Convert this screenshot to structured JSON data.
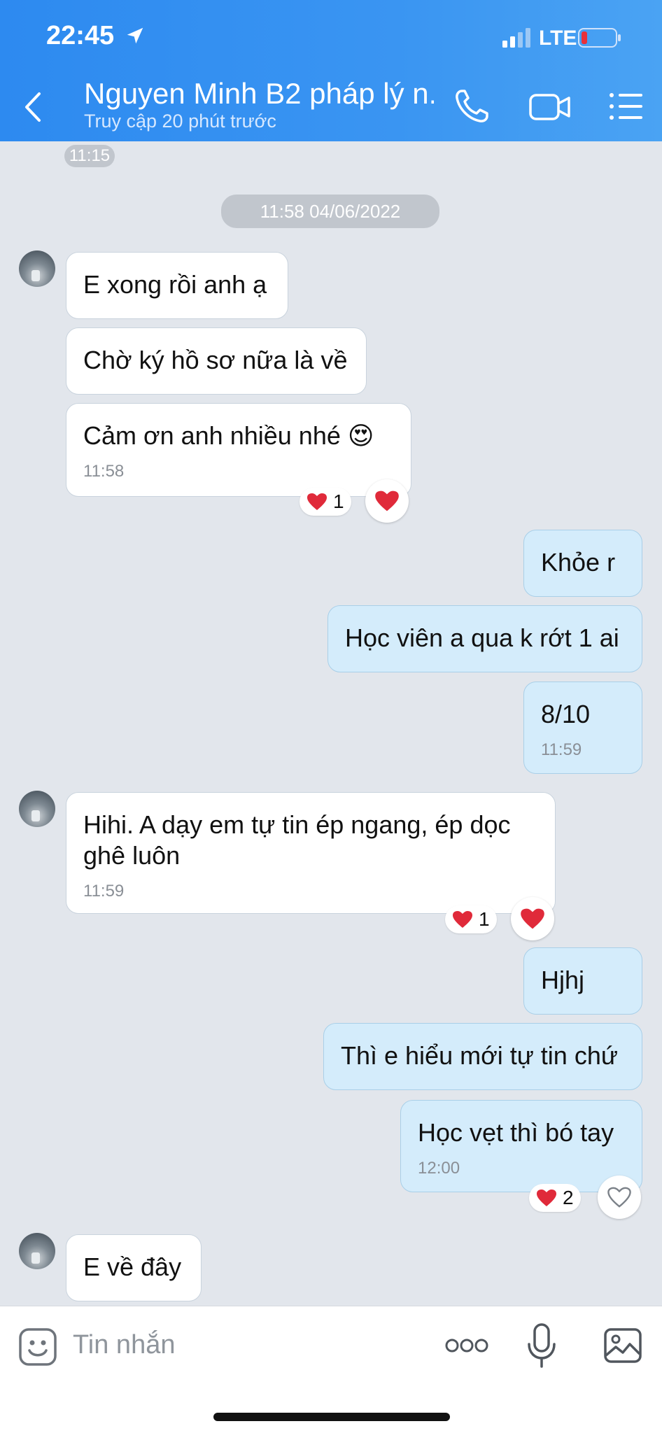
{
  "status": {
    "time": "22:45",
    "network": "LTE"
  },
  "header": {
    "title": "Nguyen Minh B2 pháp lý n...",
    "subtitle": "Truy cập 20 phút trước"
  },
  "timestamps": {
    "top": "11:15",
    "date_divider": "11:58 04/06/2022"
  },
  "messages": [
    {
      "text": "E xong rồi anh ạ"
    },
    {
      "text": "Chờ ký hồ sơ nữa là về"
    },
    {
      "text": "Cảm ơn anh nhiều nhé 😍",
      "time": "11:58",
      "reaction_count": "1"
    },
    {
      "text": "Khỏe r"
    },
    {
      "text": "Học viên a qua k rớt 1 ai"
    },
    {
      "text": "8/10",
      "time": "11:59"
    },
    {
      "text": "Hihi. A dạy em tự tin ép ngang, ép dọc ghê luôn",
      "time": "11:59",
      "reaction_count": "1"
    },
    {
      "text": "Hjhj"
    },
    {
      "text": "Thì e hiểu mới tự tin chứ"
    },
    {
      "text": "Học vẹt thì bó tay",
      "time": "12:00",
      "reaction_count": "2"
    },
    {
      "text": "E về đây"
    }
  ],
  "input": {
    "placeholder": "Tin nhắn"
  },
  "colors": {
    "header": "#3a95f2",
    "outgoing": "#d4ecfb",
    "incoming": "#ffffff",
    "heart": "#e02a3a"
  }
}
